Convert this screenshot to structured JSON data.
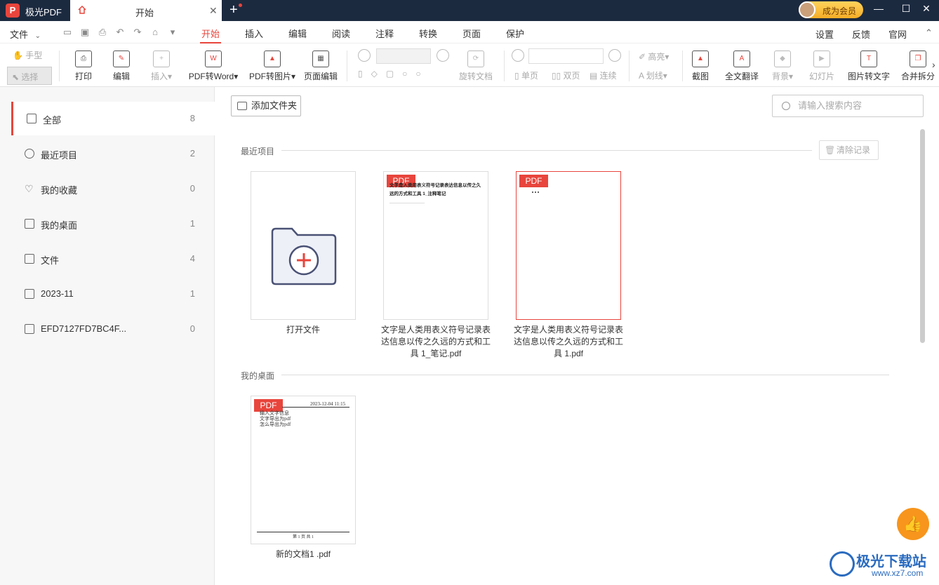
{
  "titlebar": {
    "app_name": "极光PDF",
    "tab_title": "开始",
    "member_label": "成为会员"
  },
  "menubar": {
    "file": "文件",
    "items": [
      "开始",
      "插入",
      "编辑",
      "阅读",
      "注释",
      "转换",
      "页面",
      "保护"
    ],
    "right": [
      "设置",
      "反馈",
      "官网"
    ]
  },
  "toolbar": {
    "hand": "手型",
    "select": "选择",
    "print": "打印",
    "edit": "编辑",
    "insert": "插入▾",
    "pdf2word": "PDF转Word▾",
    "pdf2img": "PDF转图片▾",
    "page_edit": "页面编辑",
    "rotate": "旋转文档",
    "single": "单页",
    "double": "双页",
    "continuous": "连续",
    "highlight": "高亮▾",
    "strike": "划线▾",
    "background": "背景▾",
    "slideshow": "幻灯片",
    "screenshot": "截图",
    "translate": "全文翻译",
    "img2text": "图片转文字",
    "merge": "合并拆分"
  },
  "sidebar": {
    "items": [
      {
        "label": "全部",
        "count": "8"
      },
      {
        "label": "最近项目",
        "count": "2"
      },
      {
        "label": "我的收藏",
        "count": "0"
      },
      {
        "label": "我的桌面",
        "count": "1"
      },
      {
        "label": "文件",
        "count": "4"
      },
      {
        "label": "2023-11",
        "count": "1"
      },
      {
        "label": "EFD7127FD7BC4F...",
        "count": "0"
      }
    ]
  },
  "main": {
    "add_folder": "添加文件夹",
    "search_placeholder": "请输入搜索内容",
    "recent_title": "最近项目",
    "clear_records": "清除记录",
    "desktop_title": "我的桌面",
    "open_file": "打开文件",
    "badge": "PDF",
    "recent_files": [
      {
        "name": "文字是人类用表义符号记录表达信息以传之久远的方式和工具 1_笔记.pdf",
        "preview_title": "文字是人类用表义符号记录表达信息以传之久远的方式和工具 1_注释笔记"
      },
      {
        "name": "文字是人类用表义符号记录表达信息以传之久远的方式和工具 1.pdf"
      }
    ],
    "desktop_files": [
      {
        "name": "新的文档1 .pdf",
        "preview_date": "2023-12-04 11:15",
        "preview_lines": [
          "输入文字信息",
          "文字导出为pdf",
          "怎么导出为pdf"
        ],
        "preview_footer": "第 1 页 共 1"
      }
    ]
  },
  "watermark": {
    "title": "极光下载站",
    "url": "www.xz7.com"
  },
  "colors": {
    "accent": "#e8453c",
    "titlebar": "#1c2a40",
    "like_button": "#f7951c"
  }
}
